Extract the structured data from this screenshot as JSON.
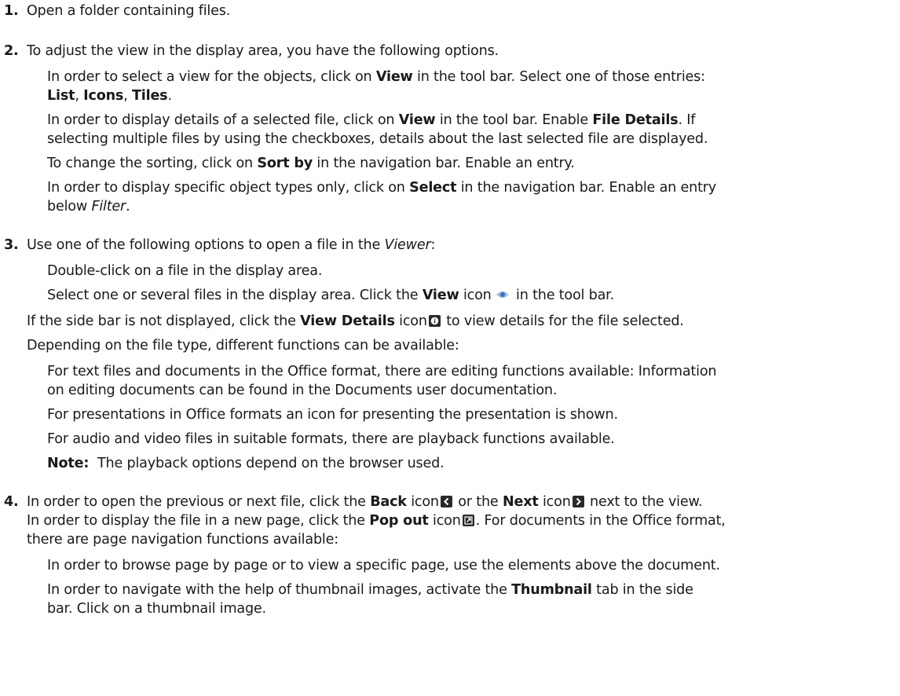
{
  "steps": [
    {
      "num": "1.",
      "text": "Open a folder containing files."
    },
    {
      "num": "2.",
      "text": "To adjust the view in the display area, you have the following options."
    },
    {
      "num": "3.",
      "text_before": "Use one of the following options to open a file in the ",
      "viewer": "Viewer",
      "text_after": ":"
    },
    {
      "num": "4.",
      "text_a": "In order to open the previous or next file, click the ",
      "back": "Back",
      "text_b": " icon",
      "text_c": " or the ",
      "next": "Next",
      "text_d": " icon",
      "text_e": " next to the view."
    }
  ],
  "step2": {
    "opt1_a": "In order to select a view for the objects, click on ",
    "opt1_view": "View",
    "opt1_b": " in the tool bar. Select one of those entries:",
    "opt1_list": "List",
    "opt1_comma1": ", ",
    "opt1_icons": "Icons",
    "opt1_comma2": ", ",
    "opt1_tiles": "Tiles",
    "opt1_dot": ".",
    "opt2_a": "In order to display details of a selected file, click on ",
    "opt2_view": "View",
    "opt2_b": " in the tool bar. Enable ",
    "opt2_fd": "File Details",
    "opt2_c": ". If",
    "opt2_line2": "selecting multiple files by using the checkboxes, details about the last selected file are displayed.",
    "opt3_a": "To change the sorting, click on ",
    "opt3_sort": "Sort by",
    "opt3_b": " in the navigation bar. Enable an entry.",
    "opt4_a": "In order to display specific object types only, click on ",
    "opt4_select": "Select",
    "opt4_b": " in the navigation bar. Enable an entry",
    "opt4_line2_a": "below ",
    "opt4_filter": "Filter",
    "opt4_line2_b": "."
  },
  "step3": {
    "opt1": "Double-click on a file in the display area.",
    "opt2_a": "Select one or several files in the display area. Click the ",
    "opt2_view": "View",
    "opt2_b": " icon",
    "opt2_c": " in the tool bar.",
    "details_a": "If the side bar is not displayed, click the ",
    "details_b": "View Details",
    "details_c": " icon",
    "details_d": " to view details for the file selected.",
    "depending": "Depending on the file type, different functions can be available:",
    "f1_line1": "For text files and documents in the Office format, there are editing functions available: Information",
    "f1_line2": "on editing documents can be found in the Documents user documentation.",
    "f2": "For presentations in Office formats an icon for presenting the presentation is shown.",
    "f3": "For audio and video files in suitable formats, there are playback functions available.",
    "note_label": "Note:",
    "note_text": "  The playback options depend on the browser used."
  },
  "step4": {
    "popout_a": "In order to display the file in a new page, click the ",
    "popout_b": "Pop out",
    "popout_c": " icon",
    "popout_d": ". For documents in the Office format,",
    "popout_line2": "there are page navigation functions available:",
    "nav1": "In order to browse page by page or to view a specific page, use the elements above the document.",
    "nav2_a": "In order to navigate with the help of thumbnail images, activate the ",
    "nav2_b": "Thumbnail",
    "nav2_c": " tab in the side",
    "nav2_line2": "bar. Click on a thumbnail image."
  },
  "icons": {
    "eye": "eye-icon",
    "details": "info-icon",
    "back": "chevron-left-icon",
    "next": "chevron-right-icon",
    "popout": "pop-out-icon"
  },
  "colors": {
    "eye_icon": "#5b87c9",
    "dark_icon": "#2a2a2a"
  }
}
